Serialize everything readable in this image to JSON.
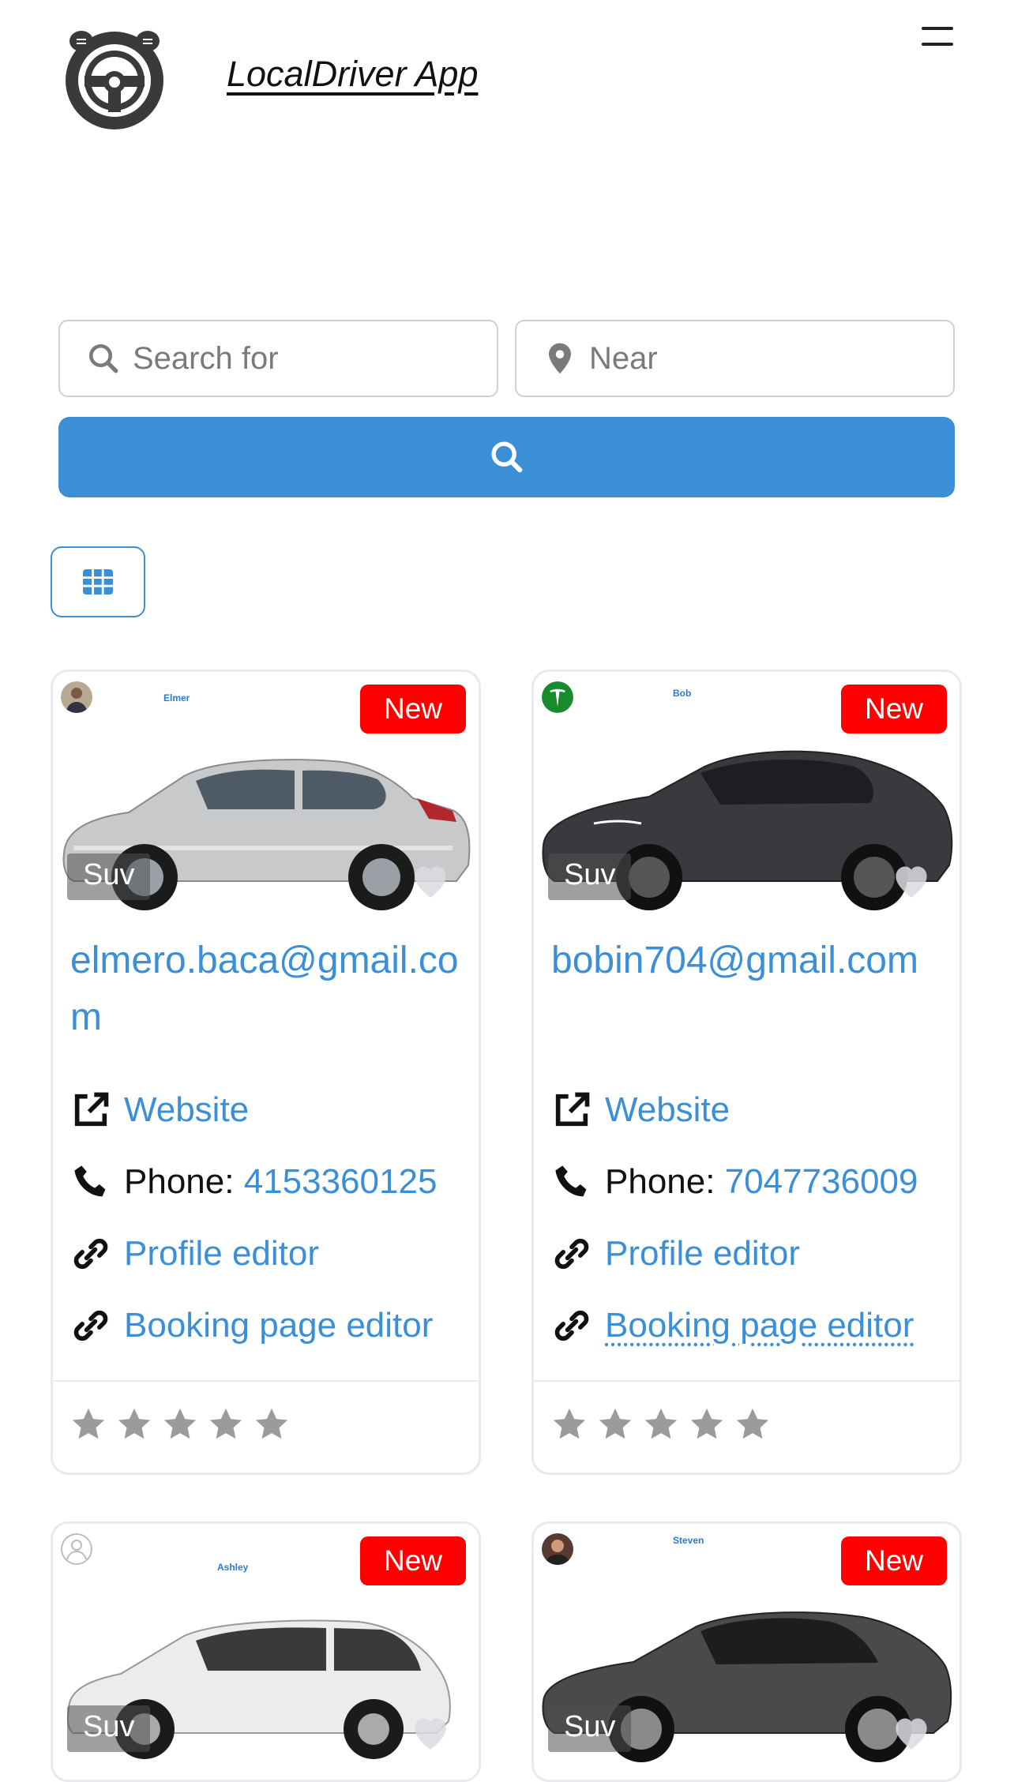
{
  "header": {
    "app_title": "LocalDriver App",
    "logo_icon": "steering-wheel-icon",
    "menu_icon": "hamburger-menu-icon"
  },
  "search": {
    "search_placeholder": "Search for",
    "near_placeholder": "Near",
    "search_icon": "magnifier-icon",
    "near_icon": "map-pin-icon",
    "button_icon": "magnifier-icon"
  },
  "view": {
    "toggle_icon": "grid-icon"
  },
  "colors": {
    "accent": "#3b8fd6",
    "badge": "#ff0000",
    "star": "#9b9b9b"
  },
  "listings": [
    {
      "owner": "Elmer",
      "badge": "New",
      "category": "Suv",
      "email": "elmero.baca@gmail.com",
      "website": "Website",
      "phone_label": "Phone:",
      "phone": "4153360125",
      "profile_editor": "Profile editor",
      "booking_editor": "Booking page editor",
      "car_color": "#c8c9cb",
      "rating": 0
    },
    {
      "owner": "Bob",
      "badge": "New",
      "category": "Suv",
      "email": "bobin704@gmail.com",
      "website": "Website",
      "phone_label": "Phone:",
      "phone": "7047736009",
      "profile_editor": "Profile editor",
      "booking_editor": "Booking page editor",
      "car_color": "#3a3a3e",
      "rating": 0
    },
    {
      "owner": "Ashley",
      "badge": "New",
      "category": "Suv",
      "car_color": "#ececec"
    },
    {
      "owner": "Steven",
      "badge": "New",
      "category": "Suv",
      "car_color": "#4a4a4c"
    }
  ]
}
